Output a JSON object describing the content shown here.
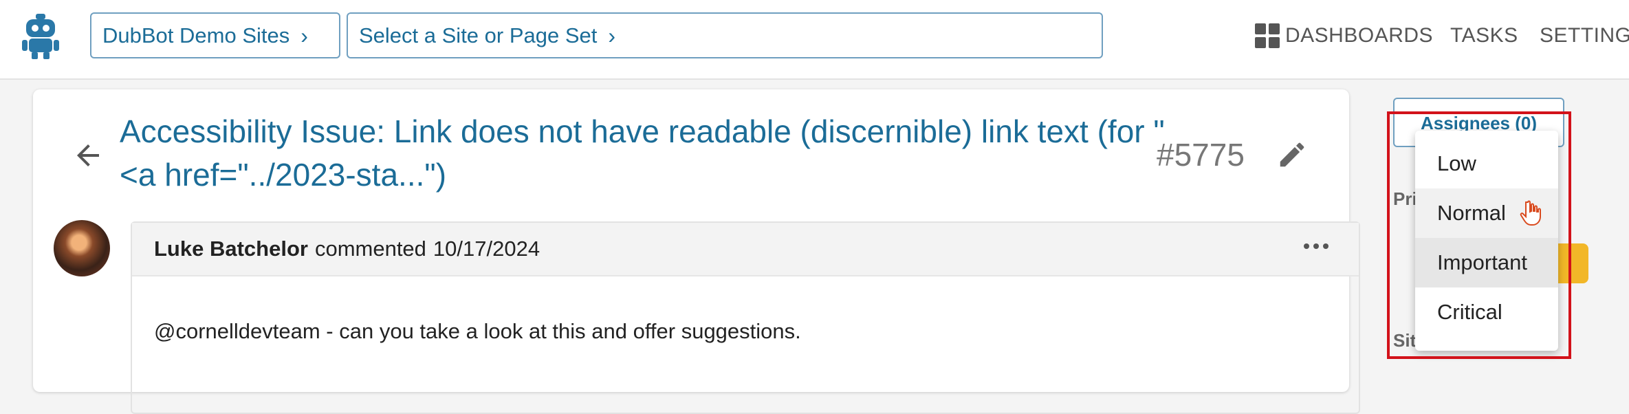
{
  "topbar": {
    "org_crumb": "DubBot Demo Sites",
    "site_crumb": "Select a Site or Page Set",
    "nav": {
      "dashboards": "DASHBOARDS",
      "tasks": "TASKS",
      "settings": "SETTING"
    }
  },
  "issue": {
    "title": "Accessibility Issue: Link does not have readable (discernible) link text (for \"<a href=\"../2023-sta...\")",
    "number": "#5775"
  },
  "comment": {
    "author": "Luke Batchelor",
    "action": "commented",
    "date": "10/17/2024",
    "body": "@cornelldevteam - can you take a look at this and offer suggestions."
  },
  "sidebar": {
    "assignees_button": "Assignees (0)",
    "priority_label": "Pri",
    "site_label": "Sit"
  },
  "priority_menu": {
    "options": [
      "Low",
      "Normal",
      "Important",
      "Critical"
    ],
    "hovered": "Normal",
    "highlighted": "Important"
  },
  "colors": {
    "accent": "#1b6c97",
    "highlight_box": "#d2121a",
    "priority_tag": "#f2b728"
  }
}
